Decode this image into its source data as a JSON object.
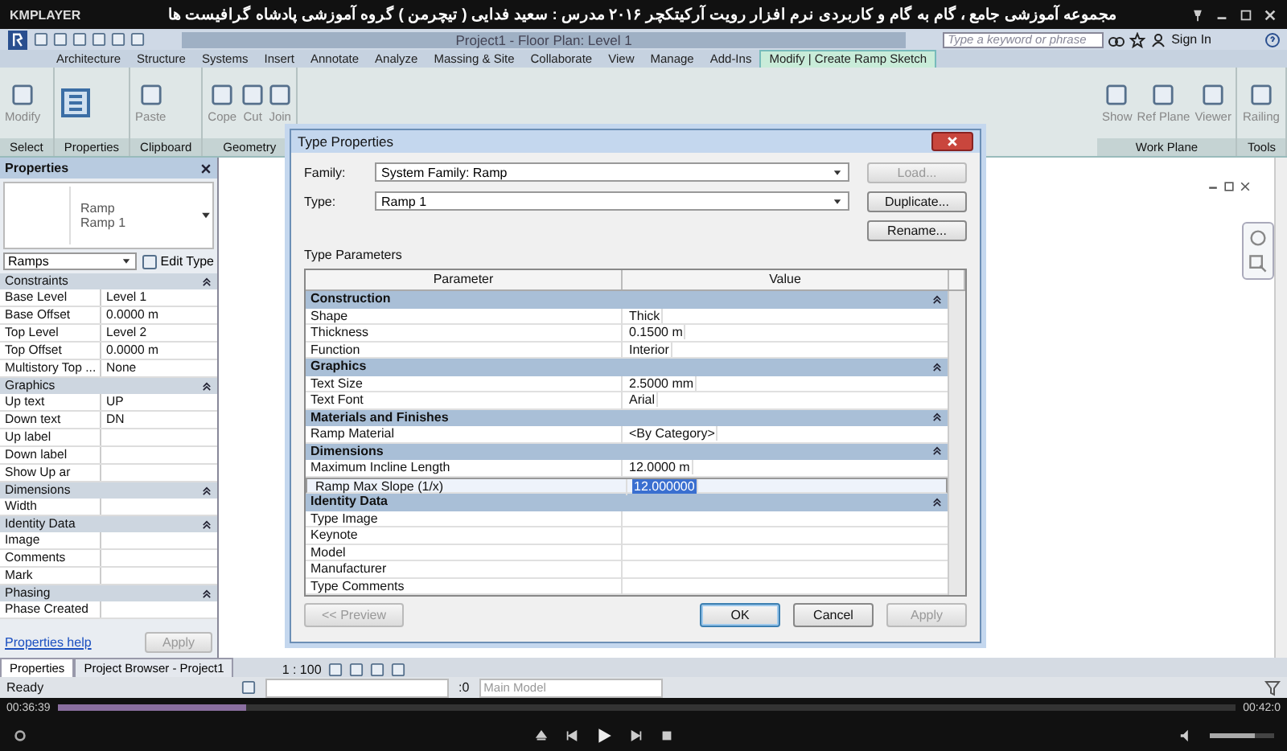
{
  "player": {
    "brand": "KMPLAYER",
    "title": "مجموعه آموزشی جامع ، گام به گام و کاربردی نرم افزار رویت آرکیتکچر ۲۰۱۶   مدرس : سعید فدایی ( تیچرمن ) گروه آموزشی پادشاه گرافیست ها",
    "elapsed": "00:36:39",
    "total": "00:42:0",
    "progress": {
      "level": 0.16
    },
    "volume": {
      "level": 0.7
    }
  },
  "revit": {
    "doc_title": "Project1 - Floor Plan: Level 1",
    "search": {
      "placeholder": "Type a keyword or phrase"
    },
    "sign_in": "Sign In",
    "tabs": [
      {
        "label": "Architecture",
        "selected": false
      },
      {
        "label": "Structure",
        "selected": false
      },
      {
        "label": "Systems",
        "selected": false
      },
      {
        "label": "Insert",
        "selected": false
      },
      {
        "label": "Annotate",
        "selected": false
      },
      {
        "label": "Analyze",
        "selected": false
      },
      {
        "label": "Massing & Site",
        "selected": false
      },
      {
        "label": "Collaborate",
        "selected": false
      },
      {
        "label": "View",
        "selected": false
      },
      {
        "label": "Manage",
        "selected": false
      },
      {
        "label": "Add-Ins",
        "selected": false
      },
      {
        "label": "Modify | Create Ramp Sketch",
        "selected": true
      }
    ],
    "ribbon_left": [
      {
        "label": "Select",
        "tools": [
          "Modify"
        ]
      },
      {
        "label": "Properties"
      },
      {
        "label": "Clipboard",
        "tools": [
          "Paste"
        ]
      },
      {
        "label": "Geometry",
        "tools": [
          "Cope",
          "Cut",
          "Join"
        ]
      }
    ],
    "ribbon_right": [
      {
        "label": "Work Plane",
        "tools": [
          "Show",
          "Ref Plane",
          "Viewer"
        ]
      },
      {
        "label": "Tools",
        "tools": [
          "Railing"
        ]
      }
    ]
  },
  "properties": {
    "title": "Properties",
    "type_family": "Ramp",
    "type_name": "Ramp 1",
    "selector": "Ramps",
    "edit_type": "Edit Type",
    "groups": [
      {
        "name": "Constraints",
        "rows": [
          {
            "name": "Base Level",
            "value": "Level 1"
          },
          {
            "name": "Base Offset",
            "value": "0.0000 m"
          },
          {
            "name": "Top Level",
            "value": "Level 2"
          },
          {
            "name": "Top Offset",
            "value": "0.0000 m"
          },
          {
            "name": "Multistory Top ...",
            "value": "None"
          }
        ]
      },
      {
        "name": "Graphics",
        "rows": [
          {
            "name": "Up text",
            "value": "UP"
          },
          {
            "name": "Down text",
            "value": "DN"
          },
          {
            "name": "Up label"
          },
          {
            "name": "Down label"
          },
          {
            "name": "Show Up ar"
          }
        ]
      },
      {
        "name": "Dimensions",
        "rows": [
          {
            "name": "Width"
          }
        ]
      },
      {
        "name": "Identity Data",
        "rows": [
          {
            "name": "Image"
          },
          {
            "name": "Comments"
          },
          {
            "name": "Mark"
          }
        ]
      },
      {
        "name": "Phasing",
        "rows": [
          {
            "name": "Phase Created"
          }
        ]
      }
    ],
    "help": "Properties help",
    "apply": "Apply"
  },
  "bottom_tabs": [
    {
      "label": "Properties",
      "selected": true
    },
    {
      "label": "Project Browser - Project1",
      "selected": false
    }
  ],
  "view_scale": "1 : 100",
  "status": {
    "text": "Ready",
    "count": ":0",
    "model": "Main Model"
  },
  "dialog": {
    "title": "Type Properties",
    "family_label": "Family:",
    "family": "System Family: Ramp",
    "type_label": "Type:",
    "type": "Ramp 1",
    "load": "Load...",
    "duplicate": "Duplicate...",
    "rename": "Rename...",
    "section": "Type Parameters",
    "columns": [
      "Parameter",
      "Value"
    ],
    "groups": [
      {
        "name": "Construction",
        "rows": [
          {
            "parameter": "Shape",
            "value": "Thick",
            "selected": false
          },
          {
            "parameter": "Thickness",
            "value": "0.1500 m",
            "selected": false
          },
          {
            "parameter": "Function",
            "value": "Interior",
            "selected": false
          }
        ]
      },
      {
        "name": "Graphics",
        "rows": [
          {
            "parameter": "Text Size",
            "value": "2.5000 mm",
            "selected": false
          },
          {
            "parameter": "Text Font",
            "value": "Arial",
            "selected": false
          }
        ]
      },
      {
        "name": "Materials and Finishes",
        "rows": [
          {
            "parameter": "Ramp Material",
            "value": "<By Category>",
            "selected": false
          }
        ]
      },
      {
        "name": "Dimensions",
        "rows": [
          {
            "parameter": "Maximum Incline Length",
            "value": "12.0000 m",
            "selected": false
          },
          {
            "parameter": "Ramp Max Slope (1/x)",
            "value": "12.000000",
            "selected": true
          }
        ]
      },
      {
        "name": "Identity Data",
        "rows": [
          {
            "parameter": "Type Image",
            "selected": false
          },
          {
            "parameter": "Keynote",
            "selected": false
          },
          {
            "parameter": "Model",
            "selected": false
          },
          {
            "parameter": "Manufacturer",
            "selected": false
          },
          {
            "parameter": "Type Comments",
            "selected": false
          }
        ]
      }
    ],
    "preview": "<< Preview",
    "ok": "OK",
    "cancel": "Cancel",
    "apply": "Apply"
  }
}
